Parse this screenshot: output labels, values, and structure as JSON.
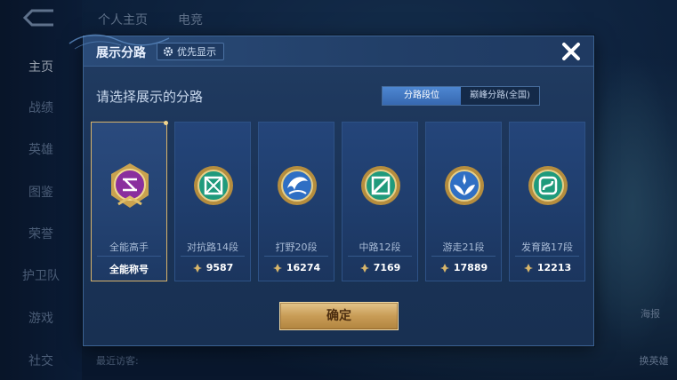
{
  "background": {
    "nav_items": [
      "主页",
      "战绩",
      "英雄",
      "图鉴",
      "荣誉",
      "护卫队",
      "游戏",
      "社交"
    ],
    "top_tabs": [
      "个人主页",
      "电竞"
    ],
    "side_buttons": [
      "海报",
      "换英雄"
    ],
    "footer_visitors": "最近访客:"
  },
  "dialog": {
    "title": "展示分路",
    "priority_button": "优先显示",
    "prompt": "请选择展示的分路",
    "toggle": {
      "options": [
        "分路段位",
        "巅峰分路(全国)"
      ],
      "active_index": 0
    },
    "lanes": [
      {
        "name": "全能高手",
        "value": "全能称号",
        "emblem": "all-round-emblem-icon",
        "selected": true,
        "color": "#b43fc0"
      },
      {
        "name": "对抗路14段",
        "value": "9587",
        "emblem": "clash-lane-emblem-icon",
        "selected": false,
        "color": "#2cae8d"
      },
      {
        "name": "打野20段",
        "value": "16274",
        "emblem": "jungle-emblem-icon",
        "selected": false,
        "color": "#3d7fd3"
      },
      {
        "name": "中路12段",
        "value": "7169",
        "emblem": "mid-lane-emblem-icon",
        "selected": false,
        "color": "#2cae8d"
      },
      {
        "name": "游走21段",
        "value": "17889",
        "emblem": "roam-emblem-icon",
        "selected": false,
        "color": "#3d7fd3"
      },
      {
        "name": "发育路17段",
        "value": "12213",
        "emblem": "farm-lane-emblem-icon",
        "selected": false,
        "color": "#2cae8d"
      }
    ],
    "confirm_label": "确定"
  },
  "colors": {
    "accent_gold": "#d9b46a",
    "toggle_active": "#3f73bd",
    "panel": "#1d375c"
  }
}
